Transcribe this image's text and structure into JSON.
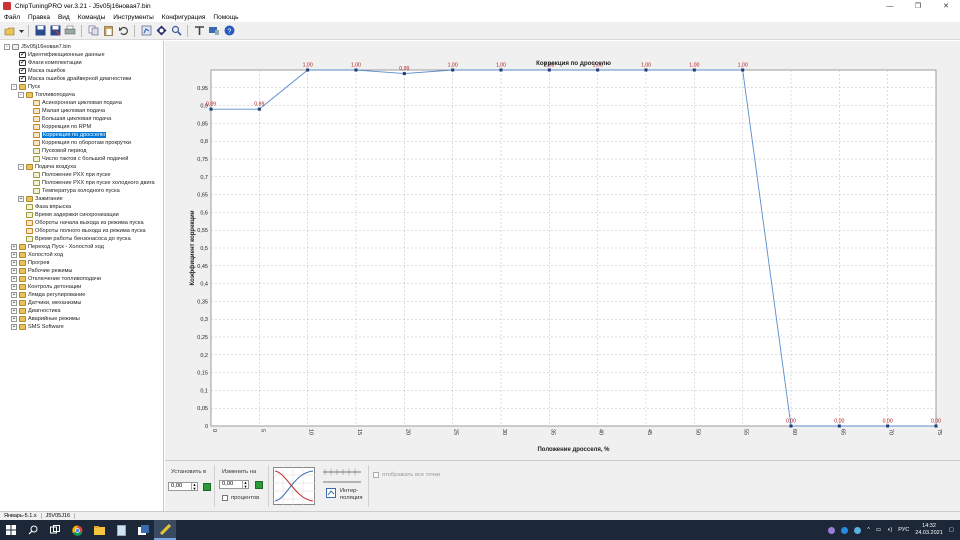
{
  "window": {
    "title": "ChipTuningPRO ver.3.21 - J5v05j16новая7.bin",
    "controls": [
      "—",
      "❐",
      "✕"
    ]
  },
  "menu": [
    "Файл",
    "Правка",
    "Вид",
    "Команды",
    "Инструменты",
    "Конфигурация",
    "Помощь"
  ],
  "toolbar": {
    "icons": [
      "open-icon",
      "save-icon",
      "save-as-icon",
      "print-icon",
      "copy-icon",
      "paste-icon",
      "undo-icon",
      "compare-icon",
      "diagnostic-icon",
      "search-icon",
      "tools-icon",
      "connection-icon",
      "help-icon"
    ]
  },
  "tree": [
    {
      "label": "J5v05j16новая7.bin",
      "level": 0,
      "icon": "file",
      "exp": "-"
    },
    {
      "label": "Идентификационные данные",
      "level": 1,
      "icon": "check"
    },
    {
      "label": "Флаги комплектации",
      "level": 1,
      "icon": "check"
    },
    {
      "label": "Маска ошибок",
      "level": 1,
      "icon": "check"
    },
    {
      "label": "Маска ошибок драйверной диагностики",
      "level": 1,
      "icon": "check"
    },
    {
      "label": "Пуск",
      "level": 1,
      "icon": "folder",
      "exp": "-"
    },
    {
      "label": "Топливоподача",
      "level": 2,
      "icon": "folder",
      "exp": "-"
    },
    {
      "label": "Асинхронная цикловая подача",
      "level": 3,
      "icon": "map"
    },
    {
      "label": "Малая цикловая подача",
      "level": 3,
      "icon": "map"
    },
    {
      "label": "Большая цикловая подача",
      "level": 3,
      "icon": "map"
    },
    {
      "label": "Коррекция по RPM",
      "level": 3,
      "icon": "map"
    },
    {
      "label": "Коррекция по дросселю",
      "level": 3,
      "icon": "map",
      "selected": true
    },
    {
      "label": "Коррекция по оборотам прокрутки",
      "level": 3,
      "icon": "map"
    },
    {
      "label": "Пусковой период",
      "level": 3,
      "icon": "curve"
    },
    {
      "label": "Число тактов с большой подачей",
      "level": 3,
      "icon": "curve"
    },
    {
      "label": "Подача воздуха",
      "level": 2,
      "icon": "folder",
      "exp": "-"
    },
    {
      "label": "Положение РХХ при пуске",
      "level": 3,
      "icon": "curve"
    },
    {
      "label": "Положение РХХ при пуске холодного двига",
      "level": 3,
      "icon": "curve"
    },
    {
      "label": "Температура холодного пуска",
      "level": 3,
      "icon": "curve"
    },
    {
      "label": "Зажигание",
      "level": 2,
      "icon": "folder",
      "exp": "+"
    },
    {
      "label": "Фаза впрыска",
      "level": 2,
      "icon": "curve"
    },
    {
      "label": "Время задержки синхронизации",
      "level": 2,
      "icon": "curve"
    },
    {
      "label": "Обороты начала выхода из режима пуска",
      "level": 2,
      "icon": "map"
    },
    {
      "label": "Обороты полного выхода из режима пуска",
      "level": 2,
      "icon": "map"
    },
    {
      "label": "Время работы бензонасоса до пуска",
      "level": 2,
      "icon": "curve"
    },
    {
      "label": "Переход Пуск - Холостой ход",
      "level": 1,
      "icon": "folder",
      "exp": "+"
    },
    {
      "label": "Холостой ход",
      "level": 1,
      "icon": "folder",
      "exp": "+"
    },
    {
      "label": "Прогрев",
      "level": 1,
      "icon": "folder",
      "exp": "+"
    },
    {
      "label": "Рабочие режимы",
      "level": 1,
      "icon": "folder",
      "exp": "+"
    },
    {
      "label": "Отключение топливоподачи",
      "level": 1,
      "icon": "folder",
      "exp": "+"
    },
    {
      "label": "Контроль детонации",
      "level": 1,
      "icon": "folder",
      "exp": "+"
    },
    {
      "label": "Лямда регулирование",
      "level": 1,
      "icon": "folder",
      "exp": "+"
    },
    {
      "label": "Датчики, механизмы",
      "level": 1,
      "icon": "folder",
      "exp": "+"
    },
    {
      "label": "Диагностика",
      "level": 1,
      "icon": "folder",
      "exp": "+"
    },
    {
      "label": "Аварийные режимы",
      "level": 1,
      "icon": "folder",
      "exp": "+"
    },
    {
      "label": "SMS Software",
      "level": 1,
      "icon": "folder",
      "exp": "+"
    }
  ],
  "chart_data": {
    "type": "line",
    "title": "Коррекция по дросселю",
    "xlabel": "Положение дросселя, %",
    "ylabel": "Коэффициент коррекции",
    "x": [
      0,
      5,
      10,
      15,
      20,
      25,
      30,
      35,
      40,
      45,
      50,
      55,
      60,
      65,
      70,
      75
    ],
    "x_tick_labels": [
      "0",
      "5",
      "10",
      "15",
      "20",
      "25",
      "30",
      "35",
      "40",
      "45",
      "50",
      "55",
      "60",
      "65",
      "70",
      "75"
    ],
    "values": [
      0.89,
      0.89,
      1.0,
      1.0,
      0.99,
      1.0,
      1.0,
      1.0,
      1.0,
      1.0,
      1.0,
      1.0,
      0.0,
      0.0,
      0.0,
      0.0
    ],
    "point_labels": [
      "0,89",
      "0,89",
      "1,00",
      "1,00",
      "0,99",
      "1,00",
      "1,00",
      "1,00",
      "1,00",
      "1,00",
      "1,00",
      "1,00",
      "0,00",
      "0,00",
      "0,00",
      "0,00"
    ],
    "y_ticks": [
      "0",
      "0,05",
      "0,1",
      "0,15",
      "0,2",
      "0,25",
      "0,3",
      "0,35",
      "0,4",
      "0,45",
      "0,5",
      "0,55",
      "0,6",
      "0,65",
      "0,7",
      "0,75",
      "0,8",
      "0,85",
      "0,9",
      "0,95"
    ],
    "ylim": [
      0,
      1.0
    ],
    "grid": true,
    "line_color": "#5b8ccc",
    "label_color": "#b02020"
  },
  "controls": {
    "set_to_label": "Установить в",
    "set_to_value": "0,00",
    "change_by_label": "Изменить на",
    "change_by_value": "0,00",
    "percent_label": "процентов",
    "interpolation_label_1": "Интер-",
    "interpolation_label_2": "поляция",
    "show_all_points_label": "отображать все точки"
  },
  "status": {
    "left": "Январь-5.1.x",
    "right": "J5V05J16"
  },
  "taskbar": {
    "lang": "РУС",
    "time": "14:32",
    "date": "24.03.2021"
  }
}
